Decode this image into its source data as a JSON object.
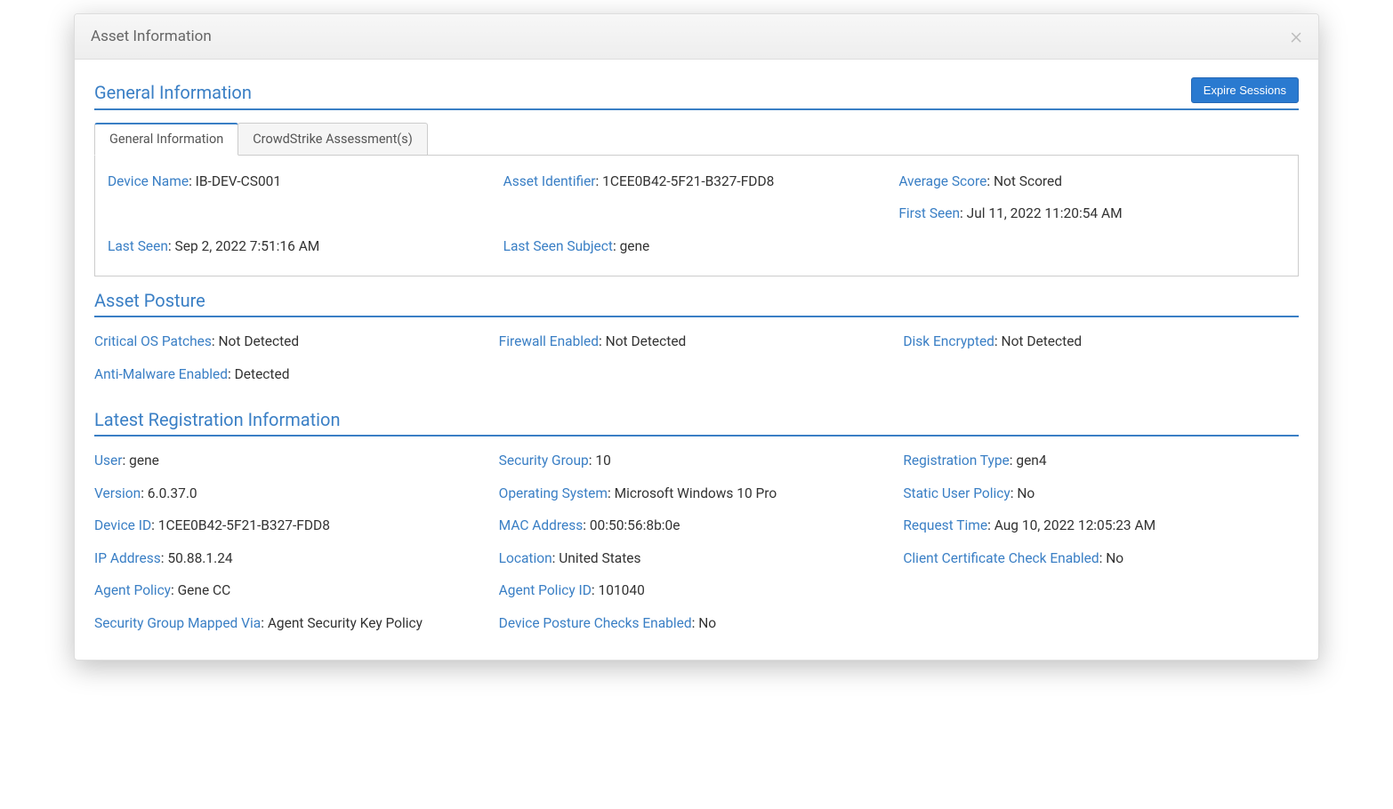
{
  "modal": {
    "title": "Asset Information",
    "expire_button": "Expire Sessions"
  },
  "tabs": {
    "general": "General Information",
    "crowdstrike": "CrowdStrike Assessment(s)"
  },
  "sections": {
    "general_info": "General Information",
    "asset_posture": "Asset Posture",
    "latest_reg": "Latest Registration Information"
  },
  "general": {
    "device_name": {
      "label": "Device Name",
      "value": "IB-DEV-CS001"
    },
    "asset_identifier": {
      "label": "Asset Identifier",
      "value": "1CEE0B42-5F21-B327-FDD8"
    },
    "average_score": {
      "label": "Average Score",
      "value": "Not Scored"
    },
    "first_seen": {
      "label": "First Seen",
      "value": "Jul 11, 2022 11:20:54 AM"
    },
    "last_seen": {
      "label": "Last Seen",
      "value": "Sep 2, 2022 7:51:16 AM"
    },
    "last_seen_subject": {
      "label": "Last Seen Subject",
      "value": "gene"
    }
  },
  "posture": {
    "critical_os_patches": {
      "label": "Critical OS Patches",
      "value": "Not Detected"
    },
    "firewall_enabled": {
      "label": "Firewall Enabled",
      "value": "Not Detected"
    },
    "disk_encrypted": {
      "label": "Disk Encrypted",
      "value": "Not Detected"
    },
    "anti_malware": {
      "label": "Anti-Malware Enabled",
      "value": "Detected"
    }
  },
  "registration": {
    "user": {
      "label": "User",
      "value": "gene"
    },
    "security_group": {
      "label": "Security Group",
      "value": "10"
    },
    "registration_type": {
      "label": "Registration Type",
      "value": "gen4"
    },
    "version": {
      "label": "Version",
      "value": "6.0.37.0"
    },
    "operating_system": {
      "label": "Operating System",
      "value": "Microsoft Windows 10 Pro"
    },
    "static_user_policy": {
      "label": "Static User Policy",
      "value": "No"
    },
    "device_id": {
      "label": "Device ID",
      "value": "1CEE0B42-5F21-B327-FDD8"
    },
    "mac_address": {
      "label": "MAC Address",
      "value": "00:50:56:8b:0e"
    },
    "request_time": {
      "label": "Request Time",
      "value": "Aug 10, 2022 12:05:23 AM"
    },
    "ip_address": {
      "label": "IP Address",
      "value": "50.88.1.24"
    },
    "location": {
      "label": "Location",
      "value": "United States"
    },
    "client_cert_check": {
      "label": "Client Certificate Check Enabled",
      "value": "No"
    },
    "agent_policy": {
      "label": "Agent Policy",
      "value": "Gene CC"
    },
    "agent_policy_id": {
      "label": "Agent Policy ID",
      "value": "101040"
    },
    "security_group_mapped": {
      "label": "Security Group Mapped Via",
      "value": "Agent Security Key Policy"
    },
    "device_posture_checks": {
      "label": "Device Posture Checks Enabled",
      "value": "No"
    }
  }
}
